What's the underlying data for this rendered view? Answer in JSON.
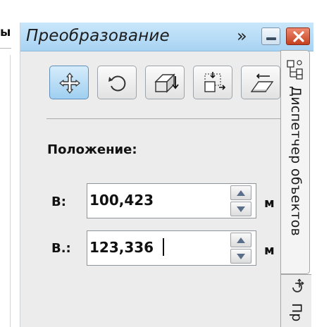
{
  "left_panel": {
    "cut_text": "ы"
  },
  "docker": {
    "title": "Преобразование",
    "chevron": "»",
    "tools": [
      {
        "name": "position",
        "icon": "move-cross-icon",
        "active": true
      },
      {
        "name": "rotate",
        "icon": "rotate-icon",
        "active": false
      },
      {
        "name": "scale-mirror",
        "icon": "scale-mirror-icon",
        "active": false
      },
      {
        "name": "size",
        "icon": "size-icon",
        "active": false
      },
      {
        "name": "skew",
        "icon": "skew-icon",
        "active": false
      }
    ],
    "section_label": "Положение:",
    "fields": [
      {
        "label": "В:",
        "value": "100,423",
        "unit": "м"
      },
      {
        "label": "В.:",
        "value": "123,336",
        "unit": "м"
      }
    ]
  },
  "side_tabs": {
    "object_manager": "Диспетчер объектов",
    "transform_short": "Пр"
  },
  "colors": {
    "titlebar": "#b8ddf6",
    "close_button": "#d9583a",
    "active_tool": "#b7dcf5",
    "panel_bg": "#ececec"
  }
}
